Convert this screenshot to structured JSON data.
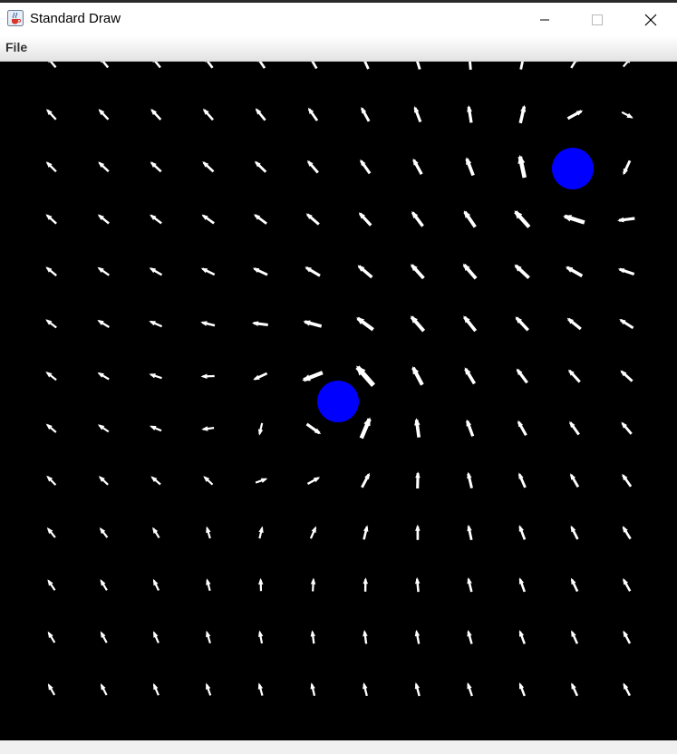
{
  "window": {
    "title": "Standard Draw",
    "controls": [
      "minimize",
      "maximize",
      "close"
    ]
  },
  "menu": {
    "items": [
      {
        "label": "File"
      }
    ]
  },
  "canvas": {
    "background": "#000000",
    "arrow_color": "#ffffff",
    "charge_color": "#0000ff",
    "arrows_shown": 156
  },
  "icons": {
    "app": "java-cup-icon",
    "minimize": "minimize-icon",
    "maximize": "maximize-icon",
    "close": "close-icon"
  }
}
